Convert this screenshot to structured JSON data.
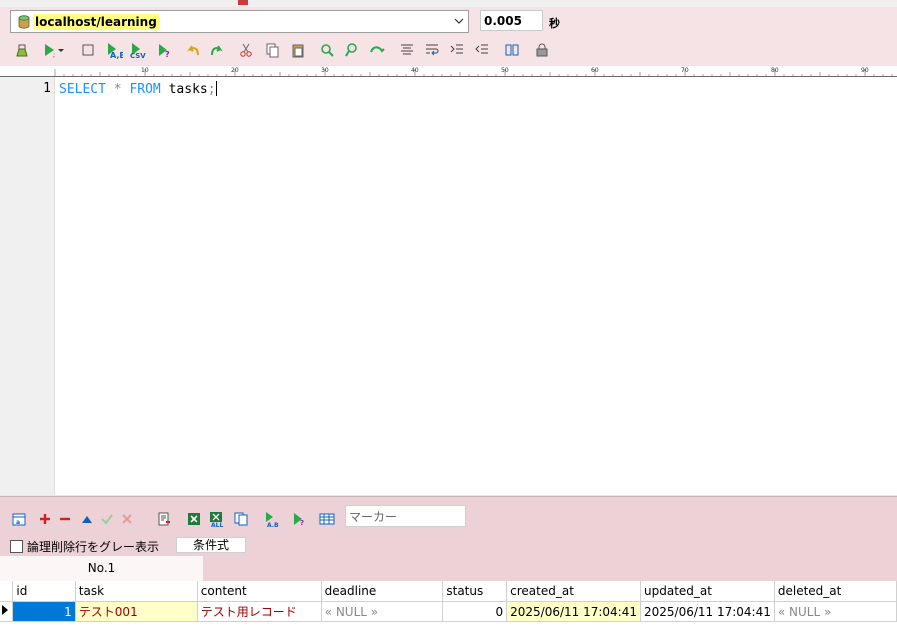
{
  "connection": {
    "name": "localhost/learning"
  },
  "exec_time": {
    "value": "0.005",
    "unit": "秒"
  },
  "ruler": {
    "labels": [
      "10",
      "20",
      "30",
      "40",
      "50",
      "60",
      "70",
      "80",
      "90"
    ]
  },
  "editor": {
    "line_number": "1",
    "tokens": [
      "SELECT",
      "*",
      "FROM",
      "tasks",
      ";"
    ]
  },
  "result": {
    "marker_placeholder": "マーカー",
    "gray_checkbox_label": "論理削除行をグレー表示",
    "condition_button": "条件式",
    "tab_label": "No.1",
    "columns": [
      "id",
      "task",
      "content",
      "deadline",
      "status",
      "created_at",
      "updated_at",
      "deleted_at"
    ],
    "rows": [
      [
        "1",
        "テスト001",
        "テスト用レコード",
        "« NULL »",
        "0",
        "2025/06/11 17:04:41",
        "2025/06/11 17:04:41",
        "« NULL »"
      ]
    ]
  }
}
